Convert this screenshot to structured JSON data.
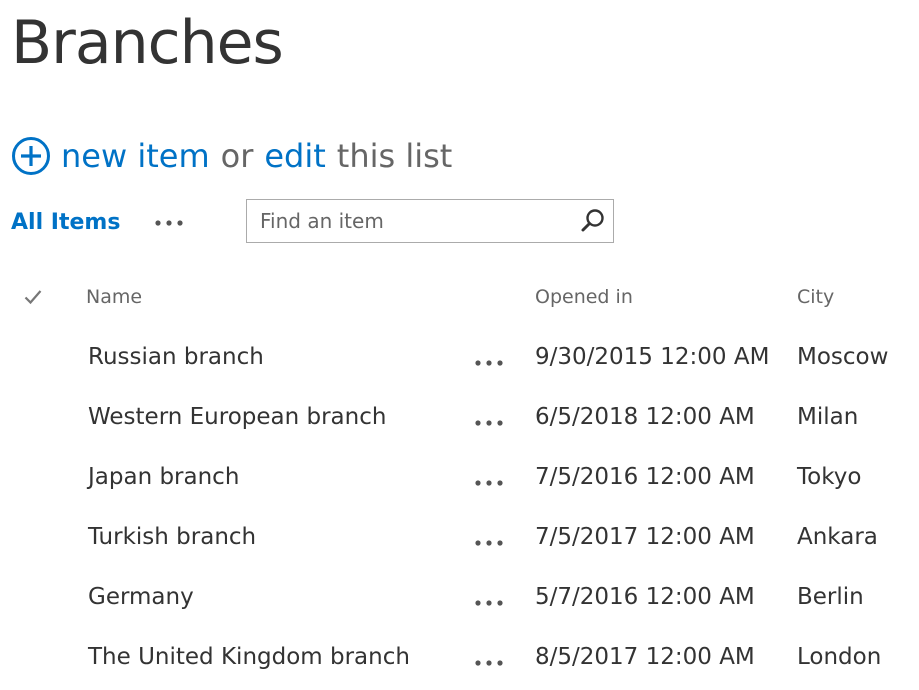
{
  "page": {
    "title": "Branches"
  },
  "actions": {
    "new_item": "new item",
    "or": "or",
    "edit": "edit",
    "this_list": "this list"
  },
  "view": {
    "current": "All Items",
    "more_icon": "ellipsis-icon"
  },
  "search": {
    "placeholder": "Find an item",
    "icon": "search-icon"
  },
  "list": {
    "columns": [
      "Name",
      "Opened in",
      "City"
    ],
    "rows": [
      {
        "name": "Russian branch",
        "opened": "9/30/2015 12:00 AM",
        "city": "Moscow"
      },
      {
        "name": "Western European branch",
        "opened": "6/5/2018 12:00 AM",
        "city": "Milan"
      },
      {
        "name": "Japan branch",
        "opened": "7/5/2016 12:00 AM",
        "city": "Tokyo"
      },
      {
        "name": "Turkish branch",
        "opened": "7/5/2017 12:00 AM",
        "city": "Ankara"
      },
      {
        "name": "Germany",
        "opened": "5/7/2016 12:00 AM",
        "city": "Berlin"
      },
      {
        "name": "The United Kingdom branch",
        "opened": "8/5/2017 12:00 AM",
        "city": "London"
      }
    ]
  },
  "colors": {
    "accent": "#0072c6",
    "text": "#333333",
    "muted": "#666666"
  }
}
